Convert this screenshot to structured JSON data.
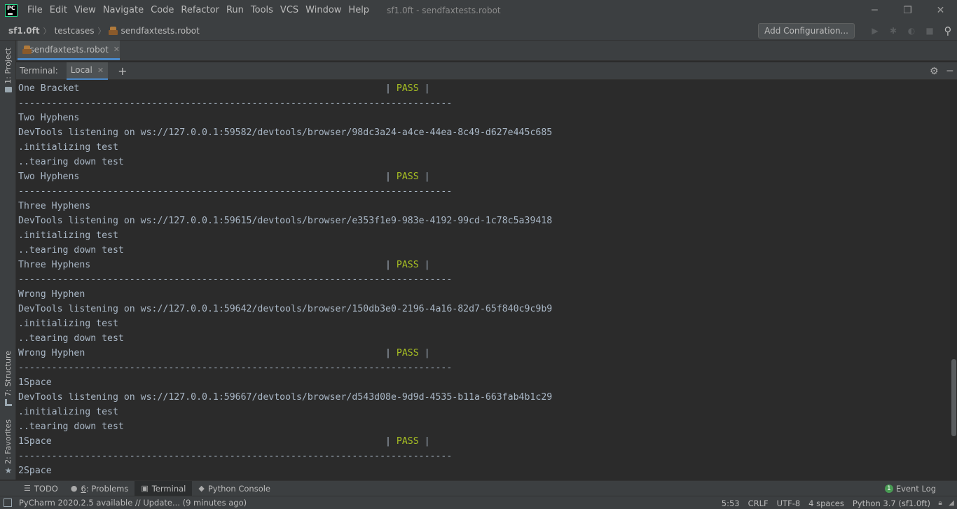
{
  "window": {
    "title": "sf1.0ft - sendfaxtests.robot",
    "controls": {
      "minimize": "─",
      "restore": "❐",
      "close": "✕"
    }
  },
  "app": {
    "logo_text": "PC"
  },
  "menu": [
    "File",
    "Edit",
    "View",
    "Navigate",
    "Code",
    "Refactor",
    "Run",
    "Tools",
    "VCS",
    "Window",
    "Help"
  ],
  "breadcrumbs": {
    "project": "sf1.0ft",
    "folder": "testcases",
    "file": "sendfaxtests.robot",
    "separator": "〉"
  },
  "toolbar": {
    "add_configuration": "Add Configuration..."
  },
  "left_strip": {
    "project": "1: Project",
    "structure": "7: Structure",
    "favorites": "2: Favorites"
  },
  "editor_tab": {
    "label": "sendfaxtests.robot",
    "close": "✕"
  },
  "terminal": {
    "title": "Terminal:",
    "tab": "Local",
    "tab_close": "✕",
    "add": "+",
    "lines": [
      {
        "text": "One Bracket                                                       | ",
        "pass": "PASS",
        "suffix": " |"
      },
      {
        "text": "------------------------------------------------------------------------------"
      },
      {
        "text": "Two Hyphens"
      },
      {
        "text": "DevTools listening on ws://127.0.0.1:59582/devtools/browser/98dc3a24-a4ce-44ea-8c49-d627e445c685"
      },
      {
        "text": ".initializing test"
      },
      {
        "text": "..tearing down test"
      },
      {
        "text": "Two Hyphens                                                       | ",
        "pass": "PASS",
        "suffix": " |"
      },
      {
        "text": "------------------------------------------------------------------------------"
      },
      {
        "text": "Three Hyphens"
      },
      {
        "text": "DevTools listening on ws://127.0.0.1:59615/devtools/browser/e353f1e9-983e-4192-99cd-1c78c5a39418"
      },
      {
        "text": ".initializing test"
      },
      {
        "text": "..tearing down test"
      },
      {
        "text": "Three Hyphens                                                     | ",
        "pass": "PASS",
        "suffix": " |"
      },
      {
        "text": "------------------------------------------------------------------------------"
      },
      {
        "text": "Wrong Hyphen"
      },
      {
        "text": "DevTools listening on ws://127.0.0.1:59642/devtools/browser/150db3e0-2196-4a16-82d7-65f840c9c9b9"
      },
      {
        "text": ".initializing test"
      },
      {
        "text": "..tearing down test"
      },
      {
        "text": "Wrong Hyphen                                                      | ",
        "pass": "PASS",
        "suffix": " |"
      },
      {
        "text": "------------------------------------------------------------------------------"
      },
      {
        "text": "1Space"
      },
      {
        "text": "DevTools listening on ws://127.0.0.1:59667/devtools/browser/d543d08e-9d9d-4535-b11a-663fab4b1c29"
      },
      {
        "text": ".initializing test"
      },
      {
        "text": "..tearing down test"
      },
      {
        "text": "1Space                                                            | ",
        "pass": "PASS",
        "suffix": " |"
      },
      {
        "text": "------------------------------------------------------------------------------"
      },
      {
        "text": "2Space"
      }
    ]
  },
  "bottom_tools": {
    "todo": "TODO",
    "problems_num": "6",
    "problems": ": Problems",
    "terminal": "Terminal",
    "python_console": "Python Console",
    "event_log": "Event Log",
    "event_count": "1"
  },
  "status": {
    "message": "PyCharm 2020.2.5 available // Update... (9 minutes ago)",
    "position": "5:53",
    "line_sep": "CRLF",
    "encoding": "UTF-8",
    "indent": "4 spaces",
    "interpreter": "Python 3.7 (sf1.0ft)"
  },
  "colors": {
    "background": "#2b2b2b",
    "panel": "#3c3f41",
    "pass": "#a8c023",
    "accent": "#4a88c7"
  }
}
